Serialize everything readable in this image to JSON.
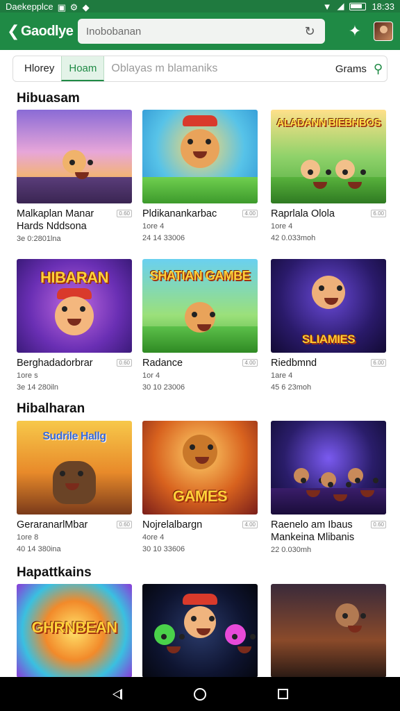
{
  "status_bar": {
    "carrier": "Daekepplce",
    "time": "18:33"
  },
  "app_bar": {
    "brand": "Gaodlye",
    "search_value": "Inobobanan"
  },
  "filter": {
    "tabs": [
      {
        "label": "Hlorey"
      },
      {
        "label": "Hoam"
      },
      {
        "label": "Oblayas m blamaniks"
      }
    ],
    "right_label": "Grams"
  },
  "sections": [
    {
      "title": "Hibuasam",
      "cards": [
        {
          "title": "Malkaplan Manar\nHards Nddsona",
          "meta1": "",
          "meta2": "3e 0:2801lna",
          "badge": "0.60"
        },
        {
          "title": "Pldikanankarbac",
          "meta1": "1ore 4",
          "meta2": "24 14 33006",
          "badge": "4.00"
        },
        {
          "title": "Raprlala Olola",
          "meta1": "1ore 4",
          "meta2": "42 0.033moh",
          "badge": "6.00"
        }
      ]
    },
    {
      "title": "",
      "cards": [
        {
          "title": "Berghadadorbrar",
          "meta1": "1ore s",
          "meta2": "3e 14 280iln",
          "badge": "0.60"
        },
        {
          "title": "Radance",
          "meta1": "1or 4",
          "meta2": "30 10 23006",
          "badge": "4.00"
        },
        {
          "title": "Riedbmnd",
          "meta1": "1are 4",
          "meta2": "45 6 23moh",
          "badge": "6.00"
        }
      ]
    },
    {
      "title": "Hibalharan",
      "cards": [
        {
          "title": "GeraranarlMbar",
          "meta1": "1ore 8",
          "meta2": "40 14 380ina",
          "badge": "0.60"
        },
        {
          "title": "Nojrelalbargn",
          "meta1": "4ore 4",
          "meta2": "30 10 33606",
          "badge": "4.00"
        },
        {
          "title": "Raenelo am Ibaus\nMankeina Mlibanis",
          "meta1": "",
          "meta2": "22 0.030mh",
          "badge": "0.60"
        }
      ]
    },
    {
      "title": "Hapattkains",
      "cards": [
        {
          "title": "",
          "meta1": "",
          "meta2": "",
          "badge": ""
        },
        {
          "title": "",
          "meta1": "",
          "meta2": "",
          "badge": ""
        },
        {
          "title": "",
          "meta1": "",
          "meta2": "",
          "badge": ""
        }
      ]
    }
  ],
  "thumb_text": {
    "r1c3": "ALADANN BIEBHBOS",
    "r2c1": "HIBARAN",
    "r2c2": "SHATIAN GAMBE",
    "r2c3": "SLIAMIES",
    "r3c1": "Sudrile Hallg",
    "r3c2": "GAMES",
    "r4c1": "GHRNBEAN"
  }
}
